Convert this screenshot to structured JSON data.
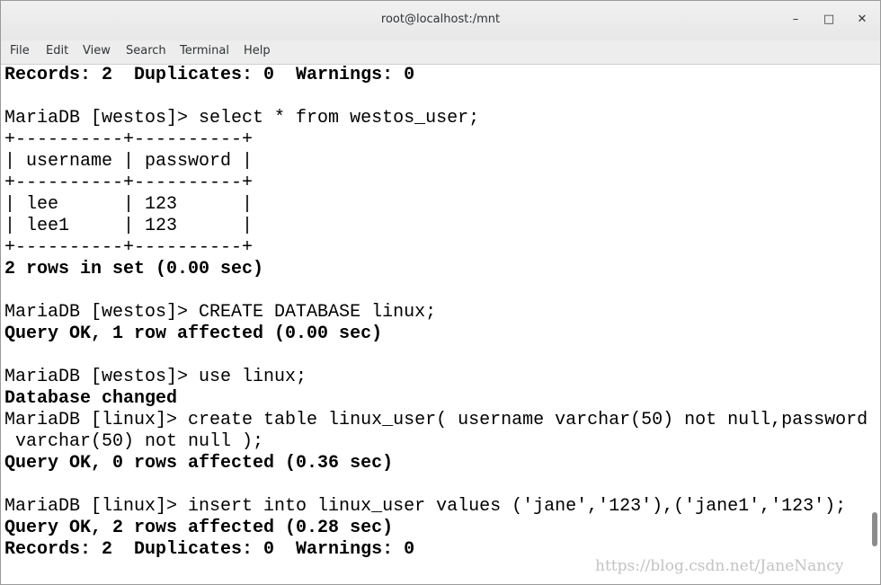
{
  "window": {
    "title": "root@localhost:/mnt",
    "controls": {
      "minimize": "–",
      "maximize": "□",
      "close": "✕"
    }
  },
  "menu": [
    "File",
    "Edit",
    "View",
    "Search",
    "Terminal",
    "Help"
  ],
  "terminal": {
    "lines": [
      {
        "text": "Records: 2  Duplicates: 0  Warnings: 0",
        "bold": true
      },
      {
        "text": "",
        "bold": false
      },
      {
        "text": "MariaDB [westos]> select * from westos_user;",
        "bold": false
      },
      {
        "text": "+----------+----------+",
        "bold": false
      },
      {
        "text": "| username | password |",
        "bold": false
      },
      {
        "text": "+----------+----------+",
        "bold": false
      },
      {
        "text": "| lee      | 123      |",
        "bold": false
      },
      {
        "text": "| lee1     | 123      |",
        "bold": false
      },
      {
        "text": "+----------+----------+",
        "bold": false
      },
      {
        "text": "2 rows in set (0.00 sec)",
        "bold": true
      },
      {
        "text": "",
        "bold": false
      },
      {
        "text": "MariaDB [westos]> CREATE DATABASE linux;",
        "bold": false
      },
      {
        "text": "Query OK, 1 row affected (0.00 sec)",
        "bold": true
      },
      {
        "text": "",
        "bold": false
      },
      {
        "text": "MariaDB [westos]> use linux;",
        "bold": false
      },
      {
        "text": "Database changed",
        "bold": true
      },
      {
        "text": "MariaDB [linux]> create table linux_user( username varchar(50) not null,password",
        "bold": false
      },
      {
        "text": " varchar(50) not null );",
        "bold": false
      },
      {
        "text": "Query OK, 0 rows affected (0.36 sec)",
        "bold": true
      },
      {
        "text": "",
        "bold": false
      },
      {
        "text": "MariaDB [linux]> insert into linux_user values ('jane','123'),('jane1','123');",
        "bold": false
      },
      {
        "text": "Query OK, 2 rows affected (0.28 sec)",
        "bold": true
      },
      {
        "text": "Records: 2  Duplicates: 0  Warnings: 0",
        "bold": true
      }
    ]
  },
  "watermark": "https://blog.csdn.net/JaneNancy"
}
